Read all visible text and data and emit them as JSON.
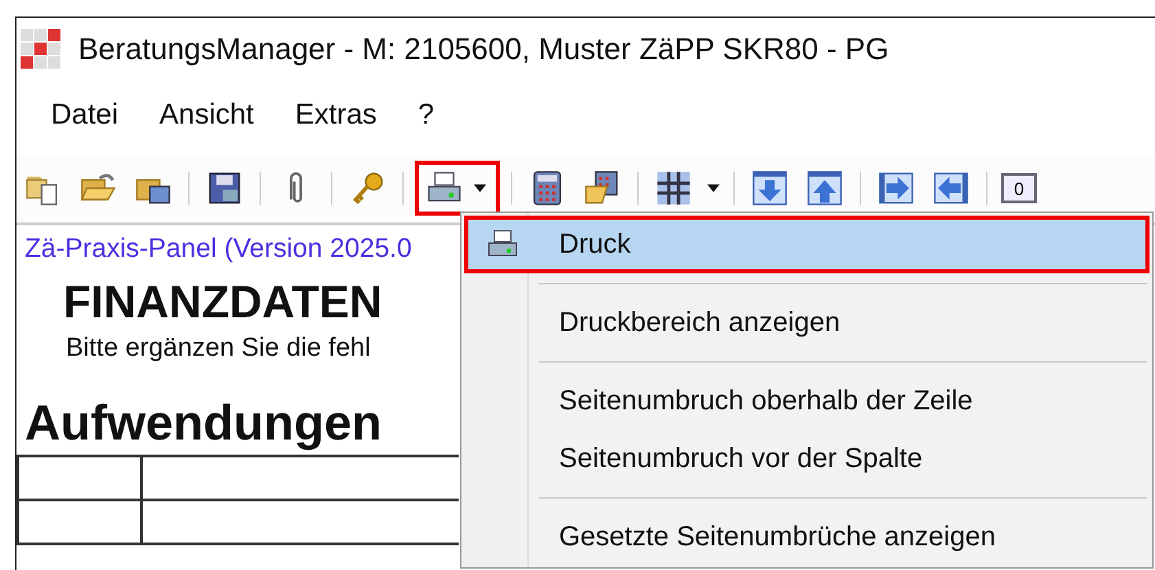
{
  "window": {
    "title": "BeratungsManager - M: 2105600, Muster ZäPP SKR80 - PG"
  },
  "menu_bar": [
    {
      "label": "Datei"
    },
    {
      "label": "Ansicht"
    },
    {
      "label": "Extras"
    },
    {
      "label": "?"
    }
  ],
  "toolbar": {
    "print_button": {
      "highlighted": true
    },
    "counter_label": "0"
  },
  "content": {
    "panel_link": "Zä-Praxis-Panel (Version 2025.0",
    "title": "FINANZDATEN",
    "subtitle": "Bitte ergänzen Sie die fehl",
    "section_heading": "Aufwendungen"
  },
  "print_menu": {
    "groups": [
      [
        {
          "label": "Druck",
          "icon": true,
          "selected": true,
          "highlighted": true
        }
      ],
      [
        {
          "label": "Druckbereich anzeigen",
          "icon": false,
          "selected": false,
          "highlighted": false
        }
      ],
      [
        {
          "label": "Seitenumbruch oberhalb der Zeile",
          "icon": false,
          "selected": false,
          "highlighted": false
        },
        {
          "label": "Seitenumbruch vor der Spalte",
          "icon": false,
          "selected": false,
          "highlighted": false
        }
      ],
      [
        {
          "label": "Gesetzte Seitenumbrüche anzeigen",
          "icon": false,
          "selected": false,
          "highlighted": false
        }
      ]
    ]
  }
}
